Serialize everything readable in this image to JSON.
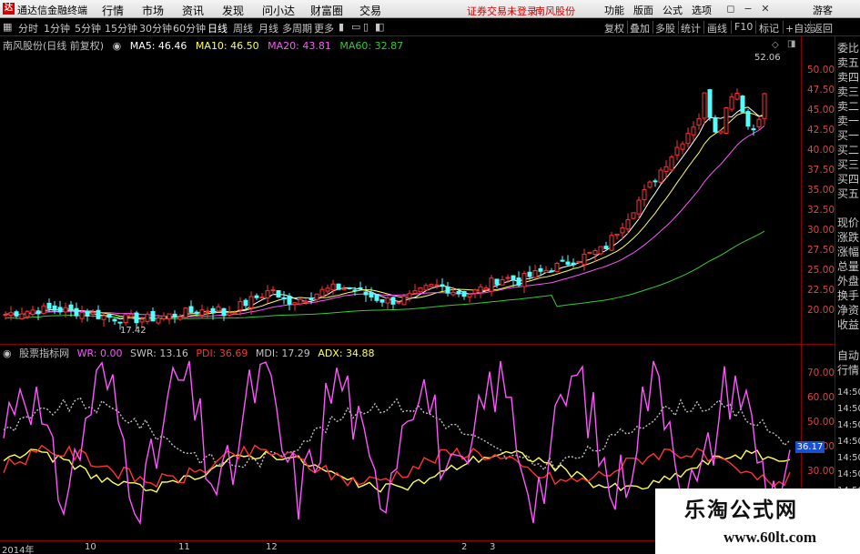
{
  "menubar": {
    "app_title": "通达信金融终端",
    "items": [
      "行情",
      "市场",
      "资讯",
      "发现",
      "问小达",
      "财富圈",
      "交易"
    ],
    "notice": "证券交易未登录",
    "stock_name": "南风股份",
    "right_items": [
      "功能",
      "版面",
      "公式",
      "选项"
    ],
    "guest": "游客"
  },
  "toolbar": {
    "periods": [
      "分时",
      "1分钟",
      "5分钟",
      "15分钟",
      "30分钟",
      "60分钟",
      "日线",
      "周线",
      "月线",
      "多周期",
      "更多"
    ],
    "active_period": "日线",
    "right_buttons": [
      "复权",
      "叠加",
      "多股",
      "统计",
      "画线",
      "F10",
      "标记",
      "+自选",
      "返回"
    ]
  },
  "main_chart": {
    "title": "南风股份(日线 前复权)",
    "ma": [
      {
        "label": "MA5: 46.46",
        "color": "#ffffff"
      },
      {
        "label": "MA10: 46.50",
        "color": "#ffff55"
      },
      {
        "label": "MA20: 43.81",
        "color": "#ff55ff"
      },
      {
        "label": "MA60: 32.87",
        "color": "#33cc33"
      }
    ],
    "price_ticks": [
      "50.00",
      "47.50",
      "45.00",
      "42.50",
      "40.00",
      "37.50",
      "35.00",
      "32.50",
      "30.00",
      "27.50",
      "25.00",
      "22.50",
      "20.00"
    ],
    "high_label": "52.06",
    "low_label": "17.42",
    "colors": {
      "up": "#ff3232",
      "down": "#54ffff",
      "ma5": "#ffffff",
      "ma10": "#ffff55",
      "ma20": "#ff55ff",
      "ma60": "#33cc33"
    }
  },
  "indicator": {
    "title": "股票指标网",
    "items": [
      {
        "label": "WR: 0.00",
        "color": "#ff55ff"
      },
      {
        "label": "SWR: 13.16",
        "color": "#c0c0c0"
      },
      {
        "label": "PDI: 36.69",
        "color": "#ff3232"
      },
      {
        "label": "MDI: 17.29",
        "color": "#c0c0c0"
      },
      {
        "label": "ADX: 34.88",
        "color": "#ffff55"
      }
    ],
    "ticks": [
      "70.00",
      "60.00",
      "50.00",
      "40.00",
      "30.00"
    ],
    "current_value": "36.17"
  },
  "quote_strip": [
    "委比",
    "卖五",
    "卖四",
    "卖三",
    "卖二",
    "卖一",
    "买一",
    "买二",
    "买三",
    "买四",
    "买五",
    "现价",
    "涨跌",
    "涨幅",
    "总量",
    "外盘",
    "换手",
    "净资",
    "收益",
    "自动",
    "行情",
    "14:50",
    "14:50",
    "14:50",
    "14:50",
    "14:50",
    "14:50",
    "14:50"
  ],
  "date_axis": [
    "2014年",
    "10",
    "11",
    "12",
    "2",
    "3"
  ],
  "watermark": {
    "line1": "乐淘公式网",
    "line2": "www.60lt.com"
  }
}
